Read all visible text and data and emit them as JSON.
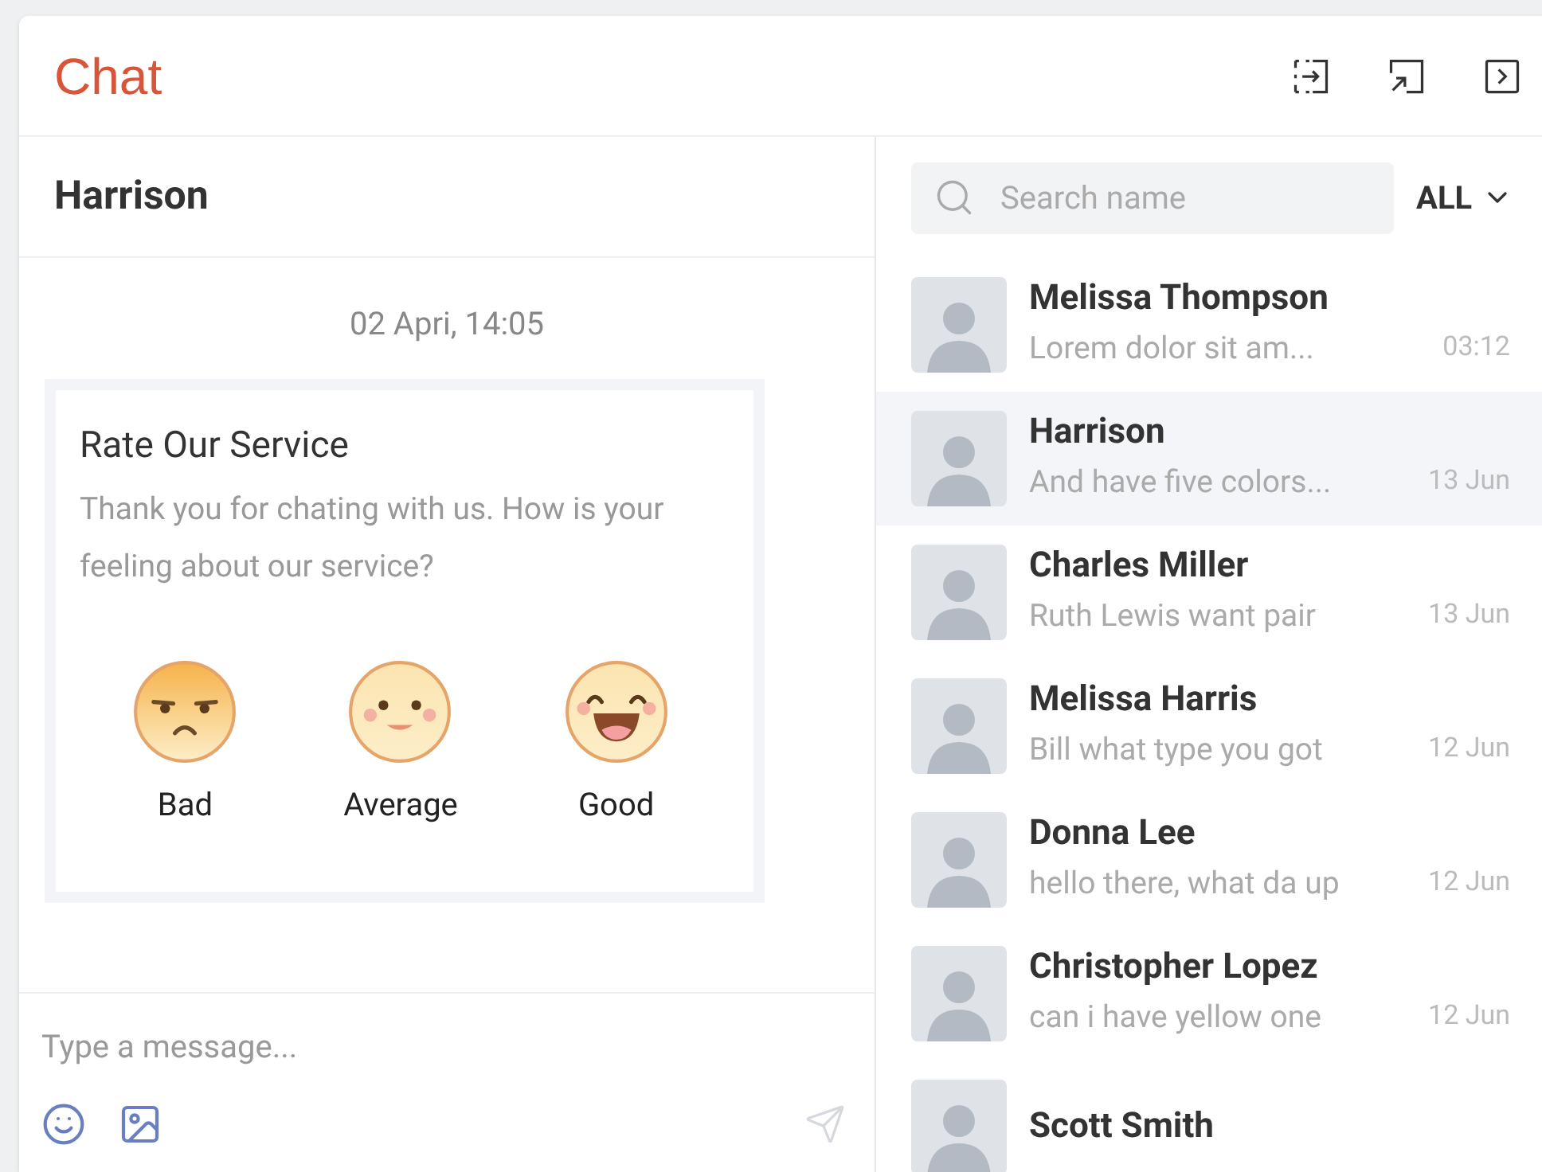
{
  "header": {
    "title": "Chat"
  },
  "conversation": {
    "name": "Harrison",
    "date": "02 Apri, 14:05",
    "rating_card": {
      "title": "Rate Our Service",
      "text": "Thank you for chating with us. How is your feeling about our service?",
      "options": [
        {
          "kind": "bad",
          "label": "Bad"
        },
        {
          "kind": "average",
          "label": "Average"
        },
        {
          "kind": "good",
          "label": "Good"
        }
      ]
    },
    "composer": {
      "placeholder": "Type a message..."
    }
  },
  "contacts": {
    "search": {
      "placeholder": "Search name"
    },
    "filter": "ALL",
    "items": [
      {
        "name": "Melissa Thompson",
        "preview": "Lorem dolor sit am...",
        "time": "03:12",
        "selected": false
      },
      {
        "name": "Harrison",
        "preview": "And have five colors...",
        "time": "13 Jun",
        "selected": true
      },
      {
        "name": "Charles Miller",
        "preview": "Ruth Lewis want pair",
        "time": "13 Jun",
        "selected": false
      },
      {
        "name": "Melissa Harris",
        "preview": "Bill what type you got",
        "time": "12 Jun",
        "selected": false
      },
      {
        "name": "Donna Lee",
        "preview": "hello there, what da up",
        "time": "12 Jun",
        "selected": false
      },
      {
        "name": "Christopher Lopez",
        "preview": "can i have yellow one",
        "time": "12 Jun",
        "selected": false
      },
      {
        "name": "Scott Smith",
        "selected": false
      }
    ]
  }
}
